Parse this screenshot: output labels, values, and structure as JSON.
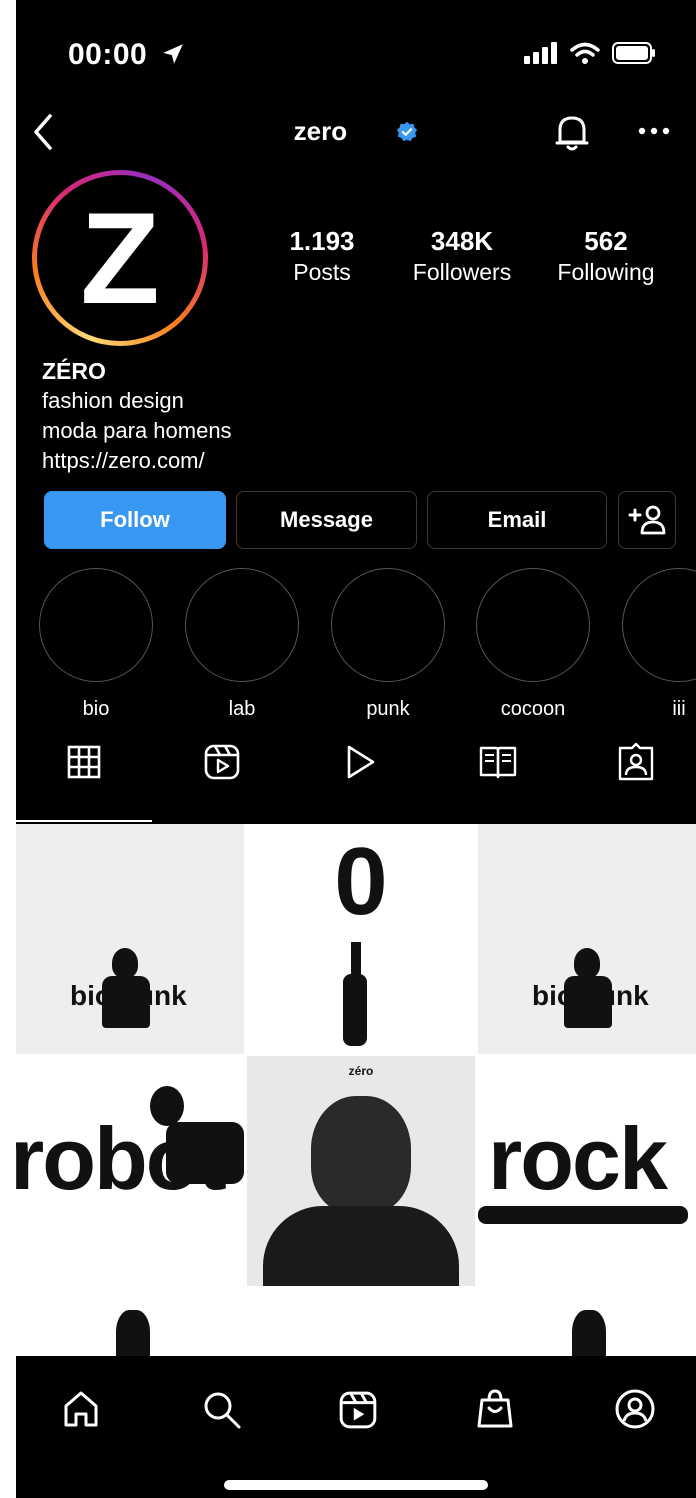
{
  "status_bar": {
    "time": "00:00"
  },
  "header": {
    "username": "zero"
  },
  "profile": {
    "avatar_letter": "Z",
    "stats": [
      {
        "value": "1.193",
        "label": "Posts"
      },
      {
        "value": "348K",
        "label": "Followers"
      },
      {
        "value": "562",
        "label": "Following"
      }
    ],
    "name": "ZÉRO",
    "bio_line1": "fashion design",
    "bio_line2": "moda para homens",
    "link": "https://zero.com/"
  },
  "actions": {
    "follow": "Follow",
    "message": "Message",
    "email": "Email"
  },
  "highlights": [
    "bio",
    "lab",
    "punk",
    "cocoon",
    "iii"
  ],
  "posts": {
    "p1": "bio punk",
    "p2": "0",
    "p3": "bio punk",
    "p4": "robot",
    "p5": "zéro",
    "p6": "rock"
  },
  "colors": {
    "follow_button": "#3897f0",
    "verified_badge": "#3897f0",
    "background": "#000000"
  }
}
